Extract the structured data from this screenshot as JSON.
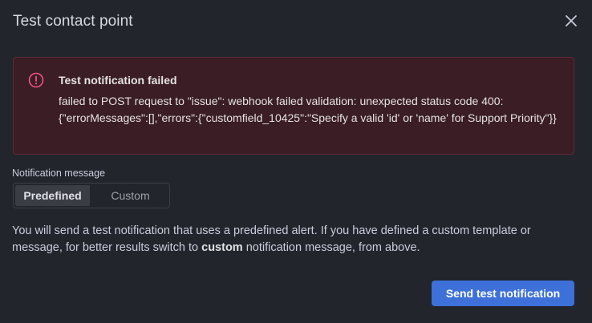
{
  "modal": {
    "title": "Test contact point",
    "close_icon": "close-icon"
  },
  "alert": {
    "icon": "exclamation-circle-icon",
    "title": "Test notification failed",
    "message": "failed to POST request to \"issue\": webhook failed validation: unexpected status code 400: {\"errorMessages\":[],\"errors\":{\"customfield_10425\":\"Specify a valid 'id' or 'name' for Support Priority\"}}",
    "accent_color": "#f0528a"
  },
  "notification_message": {
    "label": "Notification message",
    "options": [
      {
        "label": "Predefined",
        "selected": true
      },
      {
        "label": "Custom",
        "selected": false
      }
    ]
  },
  "description": {
    "before": "You will send a test notification that uses a predefined alert. If you have defined a custom template or message, for better results switch to ",
    "emphasis": "custom",
    "after": " notification message, from above."
  },
  "footer": {
    "send_label": "Send test notification",
    "accent_color": "#3d71d9"
  }
}
